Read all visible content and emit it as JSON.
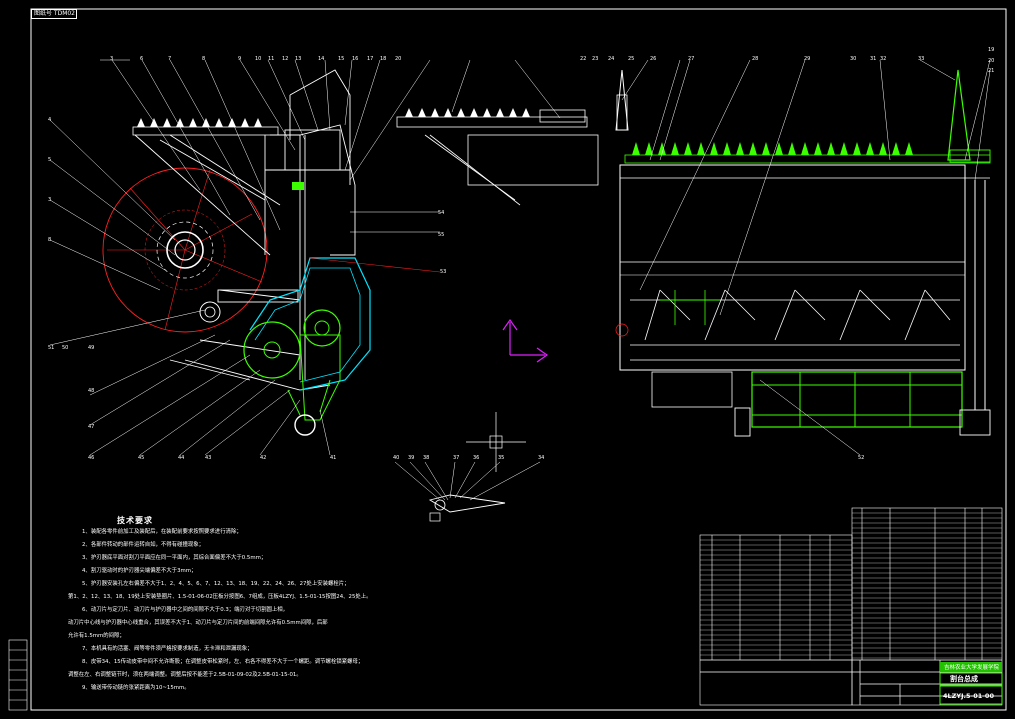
{
  "sheet": {
    "corner_tag": "图纸号 TDM02"
  },
  "notes": {
    "title": "技术要求",
    "lines": [
      "1、装配各零件前加工及装配后，在装配前要求按照要求进行清除；",
      "2、各部件转动的部件运转自如，不得有碰撞现象；",
      "3、护刃器底平面对割刀平面应在同一平面内，其综合面偏差不大于0.5mm；",
      "4、割刀驱动时的护刃器尖端偏差不大于3mm；",
      "5、护刃器安装孔左右偏差不大于1、2、4、5、6、7、12、13、18、19、22、24、26、27处上安装螺栓片；",
      "第1、2、12、13、18、19处上安装垫圈片、1.5-01-06-02压板分按图6、7组成，压板4LZYJ、1.5-01-15按图24、25处上。",
      "6、动刀片与定刀片、动刀片与护刃器中之间的间隙不大于0.3；端刃对于切割圆上相，",
      "动刀片中心线与护刃器中心线重合，其误差不大于1、动刀片与定刀片间的前端间隙允许有0.5mm间隙，后部",
      "允许有1.5mm的间隙；",
      "7、本机具有的活塞、阀等零件须严格按要求制造，无卡滞和泄漏现象；",
      "8、皮带34、15传动皮带中间不允许断股；在调整皮带松紧时，左、右各不得差不大于一个螺距。调节螺栓锁紧螺母；",
      "调整在左、右调整链节时，须在两端调整。调整后按不能差于2.5B-01-09-02及2.5B-01-15-01。",
      "9、输送带传动链的张紧距离为10~15mm。"
    ]
  },
  "title_block": {
    "school": "吉林农业大学发展学院",
    "drawing_name": "割台总成",
    "drawing_code": "4LZYJ.5-01-00"
  },
  "callouts": {
    "left_top": [
      "3",
      "6",
      "7",
      "8",
      "9",
      "10",
      "11",
      "12",
      "13",
      "14",
      "15",
      "16",
      "17",
      "18",
      "20"
    ],
    "left_side": [
      "4",
      "5",
      "3",
      "8",
      "51",
      "50",
      "49"
    ],
    "left_bottom": [
      "48",
      "47",
      "46",
      "45",
      "44",
      "43",
      "42",
      "41"
    ],
    "left_right": [
      "54",
      "55",
      "53"
    ],
    "small_bottom": [
      "40",
      "39",
      "38",
      "37",
      "36",
      "35",
      "34"
    ],
    "right_top": [
      "22",
      "23",
      "24",
      "25",
      "26",
      "27",
      "28",
      "29",
      "30",
      "31",
      "32",
      "33"
    ],
    "right_side": [
      "19",
      "20",
      "21"
    ],
    "right_bottom": [
      "52"
    ]
  },
  "colors": {
    "line": "#ffffff",
    "red": "#ff2020",
    "green": "#3cff00",
    "cyan": "#00e5ff",
    "magenta": "#e020ff",
    "yellow": "#ffff00"
  }
}
